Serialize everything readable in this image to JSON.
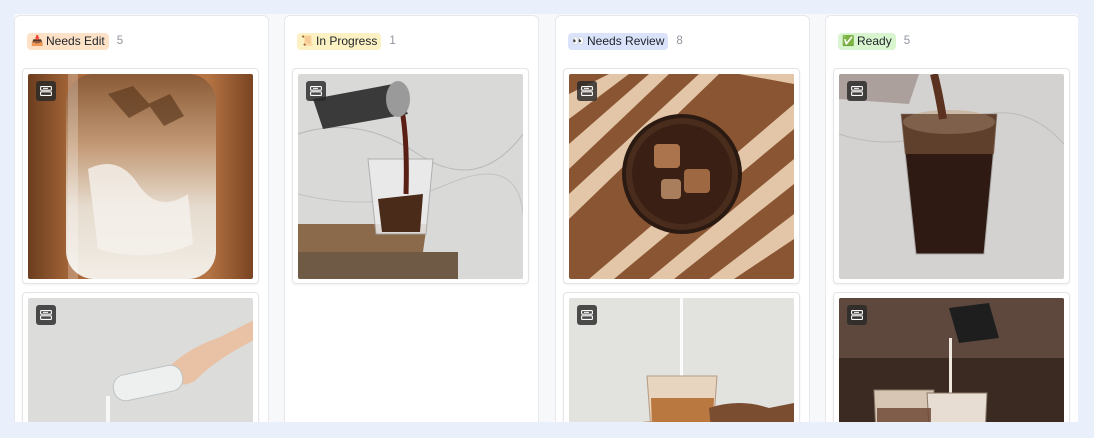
{
  "columns": [
    {
      "emoji": "📥",
      "label": "Needs Edit",
      "count": "5",
      "tag_bg": "#fde2c8"
    },
    {
      "emoji": "📜",
      "label": "In Progress",
      "count": "1",
      "tag_bg": "#fcf1c2"
    },
    {
      "emoji": "👀",
      "label": "Needs Review",
      "count": "8",
      "tag_bg": "#dbe3fb"
    },
    {
      "emoji": "✅",
      "label": "Ready",
      "count": "5",
      "tag_bg": "#d8f5cf"
    }
  ],
  "card_icon": "card-record-icon",
  "colors": {
    "page_bg": "#e9f0fb",
    "board_bg": "#f7f8fa",
    "column_bg": "#ffffff"
  }
}
